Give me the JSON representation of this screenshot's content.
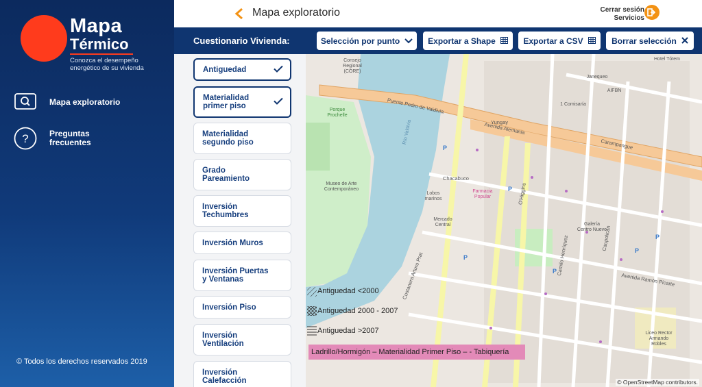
{
  "brand": {
    "title_line1": "Mapa",
    "title_line2": "Térmico",
    "subtitle": "Conozca el desempeño energético de su vivienda",
    "accent_color": "#ff3b1c"
  },
  "sidebar": {
    "items": [
      {
        "label": "Mapa exploratorio",
        "icon": "search-icon"
      },
      {
        "label": "Preguntas frecuentes",
        "icon": "question-icon"
      }
    ],
    "copyright": "© Todos los derechos reservados 2019"
  },
  "header": {
    "title": "Mapa exploratorio",
    "logout_line1": "Cerrar sesión",
    "logout_line2": "Servicios"
  },
  "toolbar": {
    "section_label": "Cuestionario Vivienda:",
    "buttons": [
      {
        "label": "Selección por punto",
        "icon": "chevron-down-icon"
      },
      {
        "label": "Exportar a Shape",
        "icon": "table-icon"
      },
      {
        "label": "Exportar a CSV",
        "icon": "table-icon"
      },
      {
        "label": "Borrar selección",
        "icon": "close-icon"
      }
    ]
  },
  "questions": [
    {
      "label": "Antiguedad",
      "selected": true
    },
    {
      "label": "Materialidad primer piso",
      "selected": true
    },
    {
      "label": "Materialidad segundo piso",
      "selected": false
    },
    {
      "label": "Grado Pareamiento",
      "selected": false
    },
    {
      "label": "Inversión Techumbres",
      "selected": false
    },
    {
      "label": "Inversión Muros",
      "selected": false
    },
    {
      "label": "Inversión Puertas y Ventanas",
      "selected": false
    },
    {
      "label": "Inversión Piso",
      "selected": false
    },
    {
      "label": "Inversión Ventilación",
      "selected": false
    },
    {
      "label": "Inversión Calefacción",
      "selected": false
    }
  ],
  "map": {
    "legend": [
      {
        "label": "Antiguedad <2000",
        "pattern": "diagonal"
      },
      {
        "label": "Antiguedad 2000 - 2007",
        "pattern": "cross"
      },
      {
        "label": "Antiguedad >2007",
        "pattern": "horizontal"
      }
    ],
    "material_legend": "Ladrillo/Hormigón – Materialidad Primer Piso – - Tabiquería",
    "attribution": "© OpenStreetMap contributors.",
    "labels": {
      "puente": "Puente Pedro de Valdivia",
      "avenida_alemania": "Avenida Alemania",
      "carampangue": "Carampangue",
      "chacabuco": "Chacabuco",
      "yungay": "Yungay",
      "ohiggins": "O'Higgins",
      "camilo_henriquez": "Camilo Henríquez",
      "caupolican": "Caupolicán",
      "picarte": "Avenida Ramón Picarte",
      "prat": "Costanera Arturo Prat",
      "rio": "Río Valdivia",
      "museo_arte": "Museo de Arte Contemporáneo",
      "mercado": "Mercado Central",
      "galeria": "Galería Centro Nuevo",
      "farmacia": "Farmacia Popular",
      "liceo": "Liceo Rector Armando Robles",
      "hotel": "Hotel Tótem",
      "comisaria": "1 Comisaría",
      "aifbn": "AIFBN",
      "janequeo": "Janequeo",
      "lobos": "Lobos marinos",
      "porque": "Porque Prochelle",
      "consejo": "Consejo Regional (CORE)"
    }
  }
}
